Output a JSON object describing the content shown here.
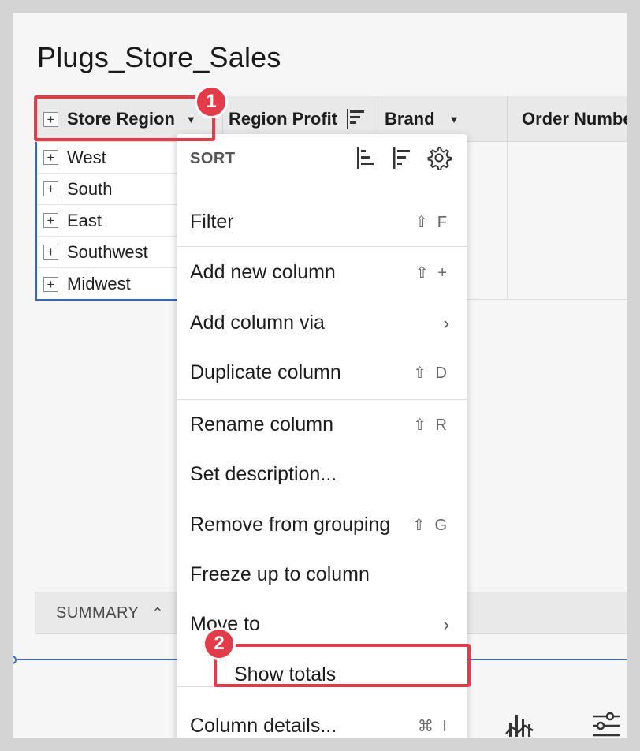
{
  "page": {
    "title": "Plugs_Store_Sales"
  },
  "table": {
    "columns": [
      {
        "label": "Store Region",
        "icon": "plus-icon",
        "menu_icon": "caret-down-icon"
      },
      {
        "label": "Region Profit",
        "icon": "sort-descending-icon"
      },
      {
        "label": "Brand",
        "menu_icon": "caret-down-icon"
      },
      {
        "label": "Order Numbe"
      }
    ],
    "rows": [
      "West",
      "South",
      "East",
      "Southwest",
      "Midwest"
    ]
  },
  "menu": {
    "sort_label": "SORT",
    "sort_icons": [
      "sort-ascending-icon",
      "sort-descending-icon",
      "gear-icon"
    ],
    "items": [
      {
        "label": "Filter",
        "shortcut": "⇧ F"
      },
      {
        "label": "Add new column",
        "shortcut": "⇧ +"
      },
      {
        "label": "Add column via",
        "arrow": "›"
      },
      {
        "label": "Duplicate column",
        "shortcut": "⇧ D"
      },
      {
        "label": "Rename column",
        "shortcut": "⇧ R"
      },
      {
        "label": "Set description...",
        "shortcut": ""
      },
      {
        "label": "Remove from grouping",
        "shortcut": "⇧ G"
      },
      {
        "label": "Freeze up to column",
        "shortcut": ""
      },
      {
        "label": "Move to",
        "arrow": "›"
      },
      {
        "label": "Show totals",
        "shortcut": ""
      },
      {
        "label": "Column details...",
        "shortcut": "⌘ I"
      }
    ]
  },
  "summary": {
    "label": "SUMMARY",
    "chevron": "⌃"
  },
  "callouts": [
    {
      "number": "1"
    },
    {
      "number": "2"
    }
  ],
  "colors": {
    "accent_blue": "#2f66d0",
    "callout_red": "#e23c4b"
  }
}
